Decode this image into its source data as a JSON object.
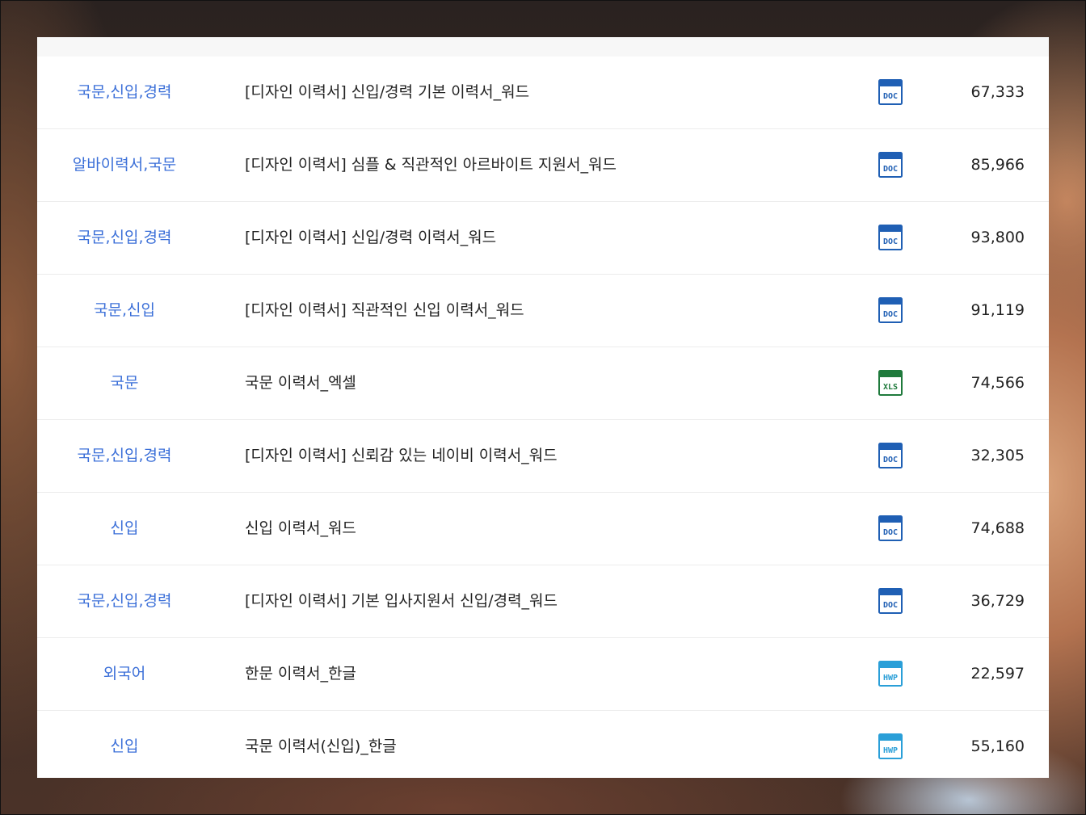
{
  "colors": {
    "category_link": "#3b6fd8",
    "doc_icon": "#1f5fb4",
    "xls_icon": "#1f7a3c",
    "hwp_icon": "#2a9fd8"
  },
  "rows": [
    {
      "category": "국문,신입,경력",
      "title": "[디자인 이력서] 신입/경력 기본 이력서_워드",
      "file_type": "DOC",
      "icon": "doc-icon",
      "downloads": "67,333"
    },
    {
      "category": "알바이력서,국문",
      "title": "[디자인 이력서] 심플 & 직관적인 아르바이트 지원서_워드",
      "file_type": "DOC",
      "icon": "doc-icon",
      "downloads": "85,966"
    },
    {
      "category": "국문,신입,경력",
      "title": "[디자인 이력서] 신입/경력 이력서_워드",
      "file_type": "DOC",
      "icon": "doc-icon",
      "downloads": "93,800"
    },
    {
      "category": "국문,신입",
      "title": "[디자인 이력서] 직관적인 신입 이력서_워드",
      "file_type": "DOC",
      "icon": "doc-icon",
      "downloads": "91,119"
    },
    {
      "category": "국문",
      "title": "국문 이력서_엑셀",
      "file_type": "XLS",
      "icon": "xls-icon",
      "downloads": "74,566"
    },
    {
      "category": "국문,신입,경력",
      "title": "[디자인 이력서] 신뢰감 있는 네이비 이력서_워드",
      "file_type": "DOC",
      "icon": "doc-icon",
      "downloads": "32,305"
    },
    {
      "category": "신입",
      "title": "신입 이력서_워드",
      "file_type": "DOC",
      "icon": "doc-icon",
      "downloads": "74,688"
    },
    {
      "category": "국문,신입,경력",
      "title": "[디자인 이력서] 기본 입사지원서 신입/경력_워드",
      "file_type": "DOC",
      "icon": "doc-icon",
      "downloads": "36,729"
    },
    {
      "category": "외국어",
      "title": "한문 이력서_한글",
      "file_type": "HWP",
      "icon": "hwp-icon",
      "downloads": "22,597"
    },
    {
      "category": "신입",
      "title": "국문 이력서(신입)_한글",
      "file_type": "HWP",
      "icon": "hwp-icon",
      "downloads": "55,160"
    }
  ]
}
